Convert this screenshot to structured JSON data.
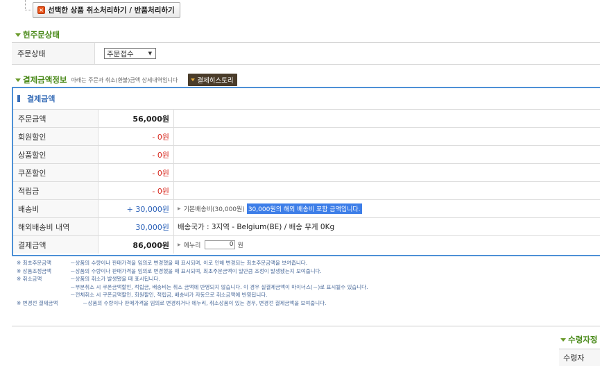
{
  "top_button": {
    "label": "선택한 상품 취소처리하기 / 반품처리하기"
  },
  "order_status_section": {
    "title": "현주문상태",
    "label": "주문상태",
    "selected": "주문접수"
  },
  "payment_section": {
    "title": "결제금액정보",
    "note": "아래는 주문과 취소(환불)금액 상세내역입니다",
    "history_button": "결제히스토리",
    "caption": "결제금액",
    "rows": [
      {
        "label": "주문금액",
        "value": "56,000원",
        "note": ""
      },
      {
        "label": "회원할인",
        "value": "- 0원",
        "note": ""
      },
      {
        "label": "상품할인",
        "value": "- 0원",
        "note": ""
      },
      {
        "label": "쿠폰할인",
        "value": "- 0원",
        "note": ""
      },
      {
        "label": "적립금",
        "value": "- 0원",
        "note": ""
      },
      {
        "label": "배송비",
        "value": "+ 30,000원",
        "note": "기본배송비(30,000원)",
        "highlight": "30,000원의 해외 배송비 포함 금액입니다."
      },
      {
        "label": "해외배송비 내역",
        "value": "30,000원",
        "note": "배송국가 : 3지역 - Belgium(BE) / 배송 무게 0Kg"
      },
      {
        "label": "결제금액",
        "value": "86,000원",
        "note": "에누리",
        "input_value": "0",
        "unit": "원"
      }
    ]
  },
  "notes": [
    {
      "title": "※ 최초주문금액",
      "text": "－상품의 수량이나 판매가격을 임의로 변경했을 때 표시되며, 이로 인해 변경되는 최초주문금액을 보여줍니다."
    },
    {
      "title": "※ 상품조정금액",
      "text": "－상품의 수량이나 판매가격을 임의로 변경했을 때 표시되며, 최초주문금액이 일만큼 조정이 발생됐는지 보여줍니다."
    },
    {
      "title": "※ 취소금액",
      "text": "－상품의 취소가 발생됐을 때 표시됩니다."
    },
    {
      "title": "",
      "text": "－부분취소 시 쿠폰금액할인, 적립금, 배송비는 취소 금액에 반영되지 않습니다. 이 경우 실결제금액이 마이너스(－)로 표시될수 있습니다."
    },
    {
      "title": "",
      "text": "－전체취소 시 쿠폰금액할인, 회원할인, 적립금, 배송비가 자동으로 취소금액에 반영됩니다."
    },
    {
      "title": "※ 변경전 결제금액",
      "text": "－상품의 수량이나 판매가격을 임의로 변경하거나 에누리, 취소상품이 있는 경우, 변경전 결제금액을 보여줍니다."
    }
  ],
  "recipient_section": {
    "title": "수령자정",
    "label": "수령자"
  }
}
